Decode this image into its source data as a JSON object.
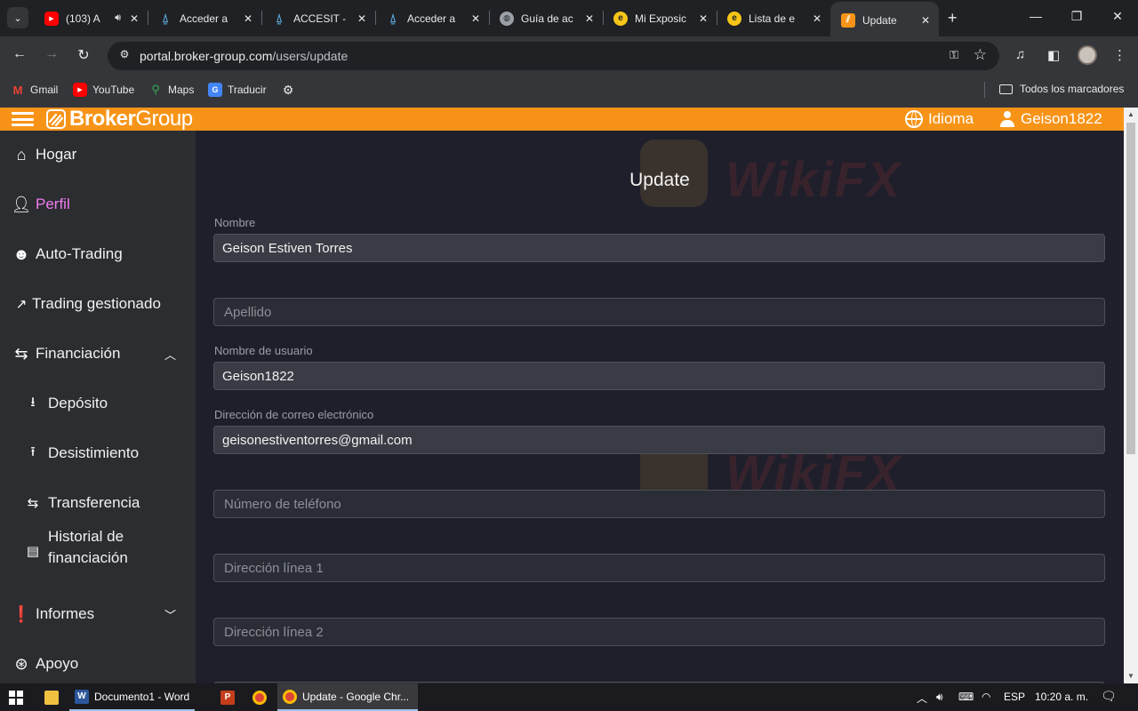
{
  "browser": {
    "tabs": [
      {
        "label": "(103) A",
        "favicon": "youtube-icon",
        "color": "#ff0000"
      },
      {
        "label": "Acceder a",
        "favicon": "page-icon",
        "color": "#5fb3e8"
      },
      {
        "label": "ACCESIT -",
        "favicon": "page-icon",
        "color": "#5fb3e8"
      },
      {
        "label": "Acceder a",
        "favicon": "page-icon",
        "color": "#5fb3e8"
      },
      {
        "label": "Guía de ac",
        "favicon": "globe-icon",
        "color": "#9aa0a6"
      },
      {
        "label": "Mi Exposic",
        "favicon": "wikifx-icon",
        "color": "#f5c518"
      },
      {
        "label": "Lista de e",
        "favicon": "wikifx-icon",
        "color": "#f5c518"
      },
      {
        "label": "Update",
        "favicon": "brokergroup-icon",
        "color": "#f79418"
      }
    ],
    "active_tab": 7,
    "url_host": "portal.broker-group.com",
    "url_path": "/users/update",
    "bookmarks": [
      {
        "label": "Gmail",
        "icon": "gmail-icon"
      },
      {
        "label": "YouTube",
        "icon": "youtube-icon"
      },
      {
        "label": "Maps",
        "icon": "maps-icon"
      },
      {
        "label": "Traducir",
        "icon": "translate-icon"
      }
    ],
    "all_bookmarks_label": "Todos los marcadores"
  },
  "header": {
    "logo_bold": "Broker",
    "logo_thin": "Group",
    "language_label": "Idioma",
    "username": "Geison1822",
    "accent": "#f79418"
  },
  "sidebar": {
    "items": [
      {
        "label": "Hogar",
        "icon": "home-icon"
      },
      {
        "label": "Perfil",
        "icon": "user-icon",
        "active": true
      },
      {
        "label": "Auto-Trading",
        "icon": "robot-icon"
      },
      {
        "label": "Trading gestionado",
        "icon": "trend-icon"
      },
      {
        "label": "Financiación",
        "icon": "exchange-icon",
        "expanded": true
      },
      {
        "label": "Depósito",
        "icon": "download-icon"
      },
      {
        "label": "Desistimiento",
        "icon": "upload-icon"
      },
      {
        "label": "Transferencia",
        "icon": "exchange-icon"
      },
      {
        "label": "Historial de financiación",
        "label_line1": "Historial de",
        "label_line2": "financiación",
        "icon": "file-icon"
      },
      {
        "label": "Informes",
        "icon": "alert-icon",
        "expanded": false
      },
      {
        "label": "Apoyo",
        "icon": "support-icon"
      }
    ]
  },
  "form": {
    "title": "Update",
    "first_name": {
      "label": "Nombre",
      "value": "Geison Estiven Torres"
    },
    "last_name": {
      "placeholder": "Apellido"
    },
    "username": {
      "label": "Nombre de usuario",
      "value": "Geison1822"
    },
    "email": {
      "label": "Dirección de correo electrónico",
      "value": "geisonestiventorres@gmail.com"
    },
    "phone": {
      "placeholder": "Número de teléfono"
    },
    "address1": {
      "placeholder": "Dirección línea 1"
    },
    "address2": {
      "placeholder": "Dirección línea 2"
    }
  },
  "watermark": "WikiFX",
  "taskbar": {
    "apps": [
      {
        "label": "Documento1 - Word",
        "icon": "word-icon"
      },
      {
        "label": "",
        "icon": "powerpoint-icon"
      },
      {
        "label": "",
        "icon": "chrome-icon"
      },
      {
        "label": "Update - Google Chr...",
        "icon": "chrome-icon"
      }
    ],
    "language": "ESP",
    "time": "10:20 a. m."
  }
}
